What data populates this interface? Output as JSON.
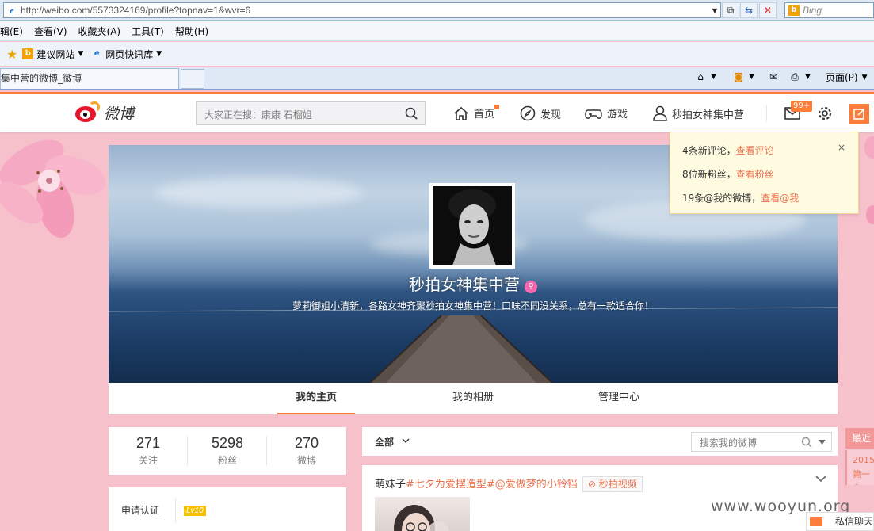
{
  "browser": {
    "url": "http://weibo.com/5573324169/profile?topnav=1&wvr=6",
    "search_engine": "Bing",
    "menu": [
      "编辑(E)",
      "查看(V)",
      "收藏夹(A)",
      "工具(T)",
      "帮助(H)"
    ],
    "menu_visible": [
      "辑(E)",
      "查看(V)",
      "收藏夹(A)",
      "工具(T)",
      "帮助(H)"
    ],
    "favorites": [
      {
        "label": "建议网站",
        "icon": "bing-icon"
      },
      {
        "label": "网页快讯库",
        "icon": "ie-icon"
      }
    ],
    "tab_title": "集中营的微博_微博",
    "page_menu": "页面(P)"
  },
  "weibo": {
    "logo_text": "微博",
    "search_placeholder": "大家正在搜：康康  石榴姐",
    "nav": [
      {
        "label": "首页",
        "icon": "home-icon"
      },
      {
        "label": "发现",
        "icon": "compass-icon"
      },
      {
        "label": "游戏",
        "icon": "gamepad-icon"
      },
      {
        "label": "秒拍女神集中营",
        "icon": "user-icon"
      }
    ],
    "message_badge": "99+",
    "notifications": [
      {
        "text": "4条新评论，",
        "link": "查看评论"
      },
      {
        "text": "8位新粉丝，",
        "link": "查看粉丝"
      },
      {
        "text": "19条@我的微博，",
        "link": "查看@我"
      }
    ],
    "close_symbol": "×"
  },
  "profile": {
    "name": "秒拍女神集中营",
    "bio": "萝莉御姐小清新，各路女神齐聚秒拍女神集中营！口味不同没关系，总有一款适合你！",
    "tabs": [
      "我的主页",
      "我的相册",
      "管理中心"
    ],
    "stats": [
      {
        "value": "271",
        "label": "关注"
      },
      {
        "value": "5298",
        "label": "粉丝"
      },
      {
        "value": "270",
        "label": "微博"
      }
    ],
    "verify_label": "申请认证",
    "level": "Lv10"
  },
  "feed": {
    "filter": "全部",
    "search_placeholder": "搜索我的微博",
    "post": {
      "author": "萌妹子",
      "topics": "#七夕为爱摆造型#@爱做梦的小铃铛",
      "video_label": "秒拍视频"
    }
  },
  "sidebar_rail": {
    "latest": "最近",
    "item_year": "2015",
    "item_text": "第一条"
  },
  "watermark": "www.wooyun.org",
  "private_chat": "私信聊天",
  "colors": {
    "accent": "#fa7d3c",
    "page_bg": "#f7c1cc",
    "link": "#eb7350"
  }
}
